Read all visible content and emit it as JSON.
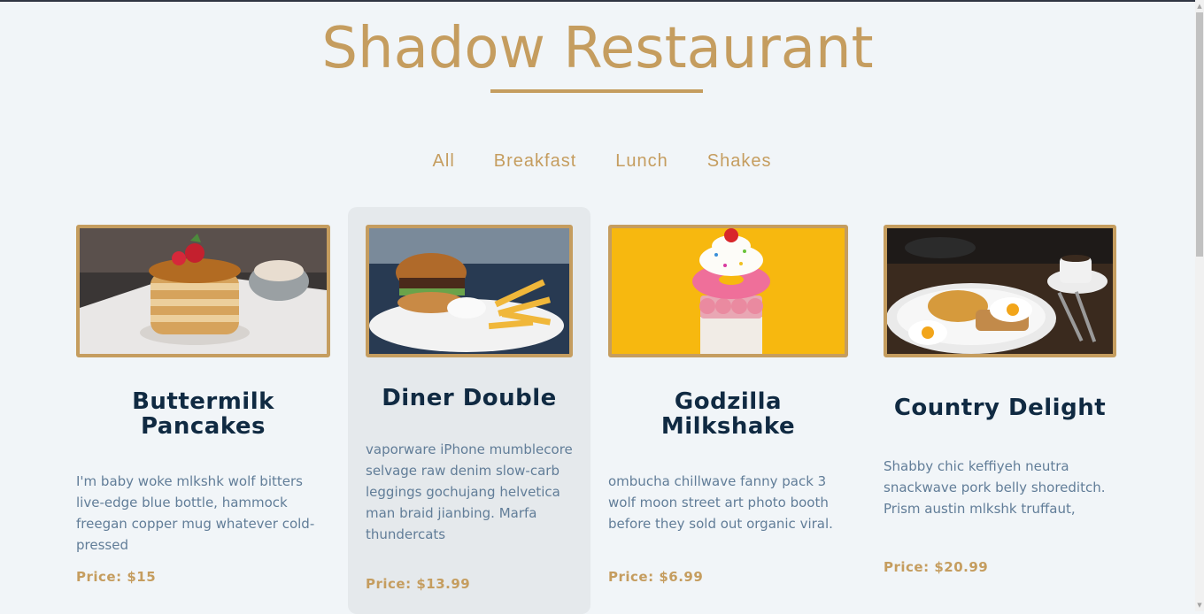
{
  "header": {
    "title": "Shadow Restaurant"
  },
  "filters": [
    {
      "label": "All"
    },
    {
      "label": "Breakfast"
    },
    {
      "label": "Lunch"
    },
    {
      "label": "Shakes"
    }
  ],
  "menu": [
    {
      "name": "Buttermilk Pancakes",
      "description": "I'm baby woke mlkshk wolf bitters live-edge blue bottle, hammock freegan copper mug whatever cold-pressed",
      "price": "Price: $15"
    },
    {
      "name": "Diner Double",
      "description": "vaporware iPhone mumblecore selvage raw denim slow-carb leggings gochujang helvetica man braid jianbing. Marfa thundercats",
      "price": "Price: $13.99"
    },
    {
      "name": "Godzilla Milkshake",
      "description": "ombucha chillwave fanny pack 3 wolf moon street art photo booth before they sold out organic viral.",
      "price": "Price: $6.99"
    },
    {
      "name": "Country Delight",
      "description": "Shabby chic keffiyeh neutra snackwave pork belly shoreditch. Prism austin mlkshk truffaut,",
      "price": "Price: $20.99"
    }
  ],
  "colors": {
    "accent": "#c59d5f",
    "heading": "#102a42",
    "body_text": "#617d98",
    "background": "#f1f5f8",
    "card_hover": "#e5e9ec"
  }
}
